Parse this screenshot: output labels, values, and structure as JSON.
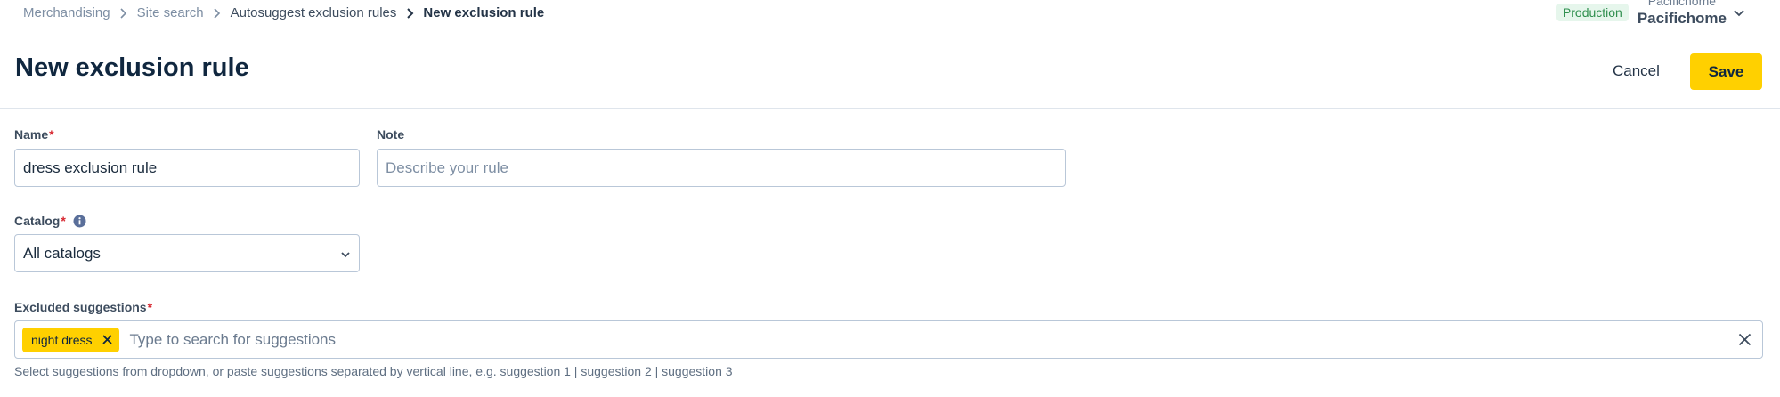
{
  "breadcrumb": {
    "items": [
      "Merchandising",
      "Site search",
      "Autosuggest exclusion rules"
    ],
    "current": "New exclusion rule"
  },
  "environment": {
    "badge": "Production",
    "store_subtitle": "Pacifichome",
    "store_name": "Pacifichome"
  },
  "header": {
    "title": "New exclusion rule",
    "cancel_label": "Cancel",
    "save_label": "Save"
  },
  "form": {
    "name": {
      "label": "Name",
      "required_mark": "*",
      "value": "dress exclusion rule"
    },
    "note": {
      "label": "Note",
      "placeholder": "Describe your rule",
      "value": ""
    },
    "catalog": {
      "label": "Catalog",
      "required_mark": "*",
      "selected": "All catalogs"
    },
    "excluded": {
      "label": "Excluded suggestions",
      "required_mark": "*",
      "chips": [
        "night dress"
      ],
      "placeholder": "Type to search for suggestions",
      "helper": "Select suggestions from dropdown, or paste suggestions separated by vertical line, e.g. suggestion 1 | suggestion 2 | suggestion 3"
    }
  },
  "colors": {
    "accent": "#ffd000",
    "required": "#d7262f",
    "production_badge_bg": "#e6f6ec",
    "production_badge_text": "#2f8f4e"
  },
  "icons": {
    "breadcrumb_separator": "chevron-right-icon",
    "store_menu": "chevron-down-icon",
    "catalog_info": "info-icon",
    "select_toggle": "chevron-down-icon",
    "chip_remove": "close-icon",
    "clear_all": "close-icon"
  }
}
